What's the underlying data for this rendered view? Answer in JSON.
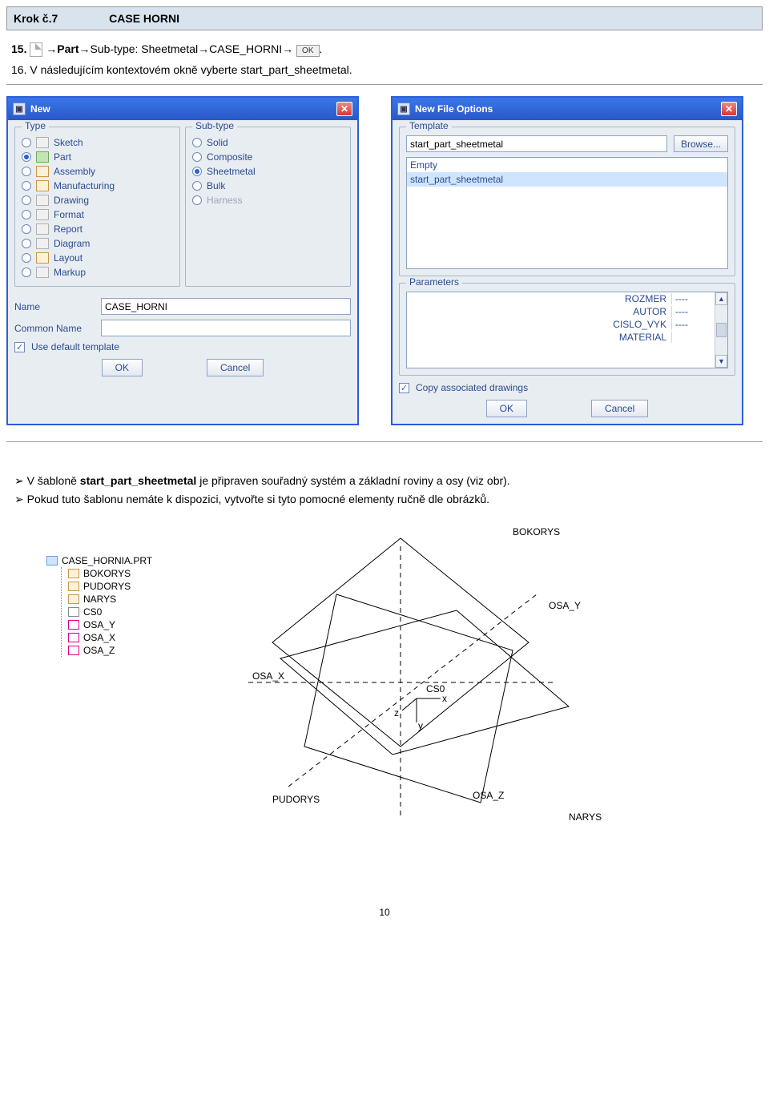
{
  "header": {
    "step": "Krok č.7",
    "case": "CASE HORNI"
  },
  "instr15": {
    "num": "15.",
    "parts": [
      "→",
      "Part",
      "→Sub-type: Sheetmetal→",
      "CASE_HORNI",
      "→"
    ],
    "ok_btn": "OK",
    "period": "."
  },
  "instr16": "16. V následujícím kontextovém okně vyberte start_part_sheetmetal.",
  "dlg_new": {
    "title": "New",
    "type_legend": "Type",
    "subtype_legend": "Sub-type",
    "types": [
      {
        "label": "Sketch",
        "checked": false,
        "icon": "pale"
      },
      {
        "label": "Part",
        "checked": true,
        "icon": "green"
      },
      {
        "label": "Assembly",
        "checked": false,
        "icon": ""
      },
      {
        "label": "Manufacturing",
        "checked": false,
        "icon": ""
      },
      {
        "label": "Drawing",
        "checked": false,
        "icon": "pale"
      },
      {
        "label": "Format",
        "checked": false,
        "icon": "pale"
      },
      {
        "label": "Report",
        "checked": false,
        "icon": "pale"
      },
      {
        "label": "Diagram",
        "checked": false,
        "icon": "pale"
      },
      {
        "label": "Layout",
        "checked": false,
        "icon": ""
      },
      {
        "label": "Markup",
        "checked": false,
        "icon": "pale"
      }
    ],
    "subtypes": [
      {
        "label": "Solid",
        "checked": false,
        "disabled": false
      },
      {
        "label": "Composite",
        "checked": false,
        "disabled": false
      },
      {
        "label": "Sheetmetal",
        "checked": true,
        "disabled": false
      },
      {
        "label": "Bulk",
        "checked": false,
        "disabled": false
      },
      {
        "label": "Harness",
        "checked": false,
        "disabled": true
      }
    ],
    "name_label": "Name",
    "name_value": "CASE_HORNI",
    "common_label": "Common Name",
    "default_tpl": "Use default template",
    "ok": "OK",
    "cancel": "Cancel"
  },
  "dlg_opts": {
    "title": "New File Options",
    "template_legend": "Template",
    "template_value": "start_part_sheetmetal",
    "browse": "Browse...",
    "list": [
      "Empty",
      "start_part_sheetmetal"
    ],
    "params_legend": "Parameters",
    "params": [
      {
        "name": "ROZMER",
        "val": "----"
      },
      {
        "name": "AUTOR",
        "val": "----"
      },
      {
        "name": "CISLO_VYK",
        "val": "----"
      },
      {
        "name": "MATERIAL",
        "val": ""
      }
    ],
    "copy_drawings": "Copy associated drawings",
    "ok": "OK",
    "cancel": "Cancel"
  },
  "bullet1_a": "V šabloně ",
  "bullet1_b": "start_part_sheetmetal",
  "bullet1_c": " je připraven souřadný systém a základní roviny a osy (viz obr).",
  "bullet2": "Pokud tuto šablonu nemáte k dispozici, vytvořte si tyto pomocné elementy ručně dle obrázků.",
  "tree": {
    "root": "CASE_HORNIA.PRT",
    "children": [
      "BOKORYS",
      "PUDORYS",
      "NARYS",
      "CS0",
      "OSA_Y",
      "OSA_X",
      "OSA_Z"
    ]
  },
  "diagram_labels": {
    "bokorys": "BOKORYS",
    "pudorys": "PUDORYS",
    "narys": "NARYS",
    "osa_x": "OSA_X",
    "osa_y": "OSA_Y",
    "osa_z": "OSA_Z",
    "cs0": "CS0",
    "x": "x",
    "y": "y",
    "z": "z"
  },
  "page_num": "10"
}
